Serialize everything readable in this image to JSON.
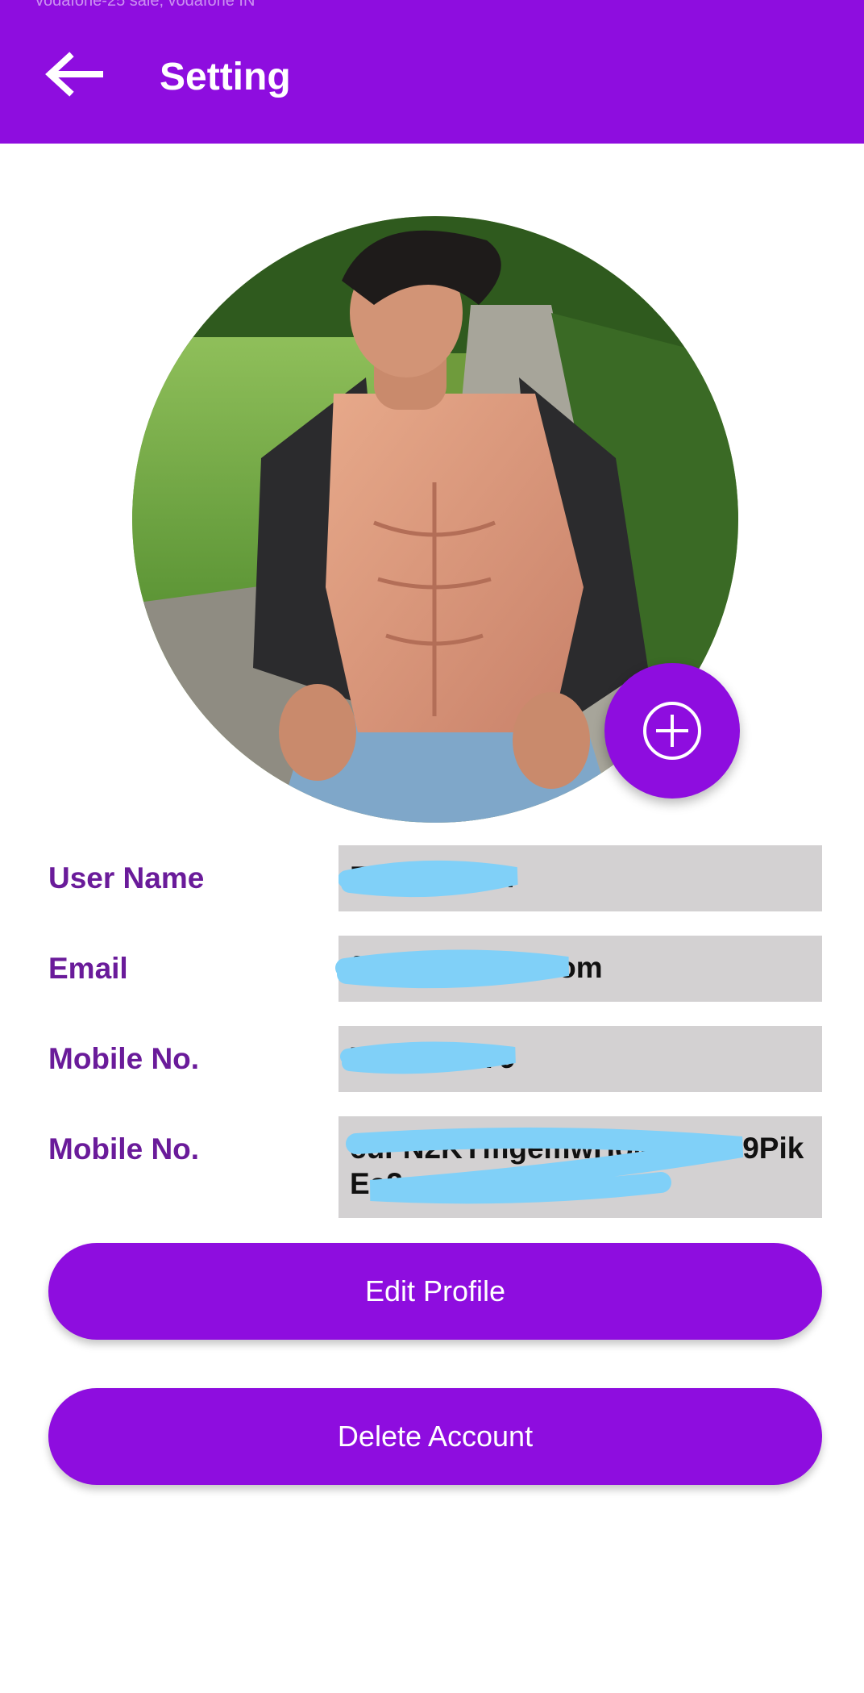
{
  "status_bar": {
    "text": "vodafone-25 sale, vodafone IN"
  },
  "app_bar": {
    "title": "Setting",
    "back_icon": "arrow-left-icon",
    "background_color": "#8e0ddf"
  },
  "profile": {
    "avatar": "profile-photo",
    "add_photo_icon": "plus-circle-icon"
  },
  "fields": [
    {
      "label": "User Name",
      "value": "Faisal Alam"
    },
    {
      "label": "Email",
      "value": "faisal@gmail.com"
    },
    {
      "label": "Mobile No.",
      "value": "7085327779"
    },
    {
      "label": "Mobile No.",
      "value": "cuFN2KYmgemwHoMdbt2C9Pik Ea2"
    }
  ],
  "buttons": {
    "edit_profile": "Edit Profile",
    "delete_account": "Delete Account"
  },
  "colors": {
    "primary": "#8e0ddf",
    "label": "#6a1b9a",
    "field_background": "#d3d1d2",
    "redaction": "#80d0f8"
  }
}
